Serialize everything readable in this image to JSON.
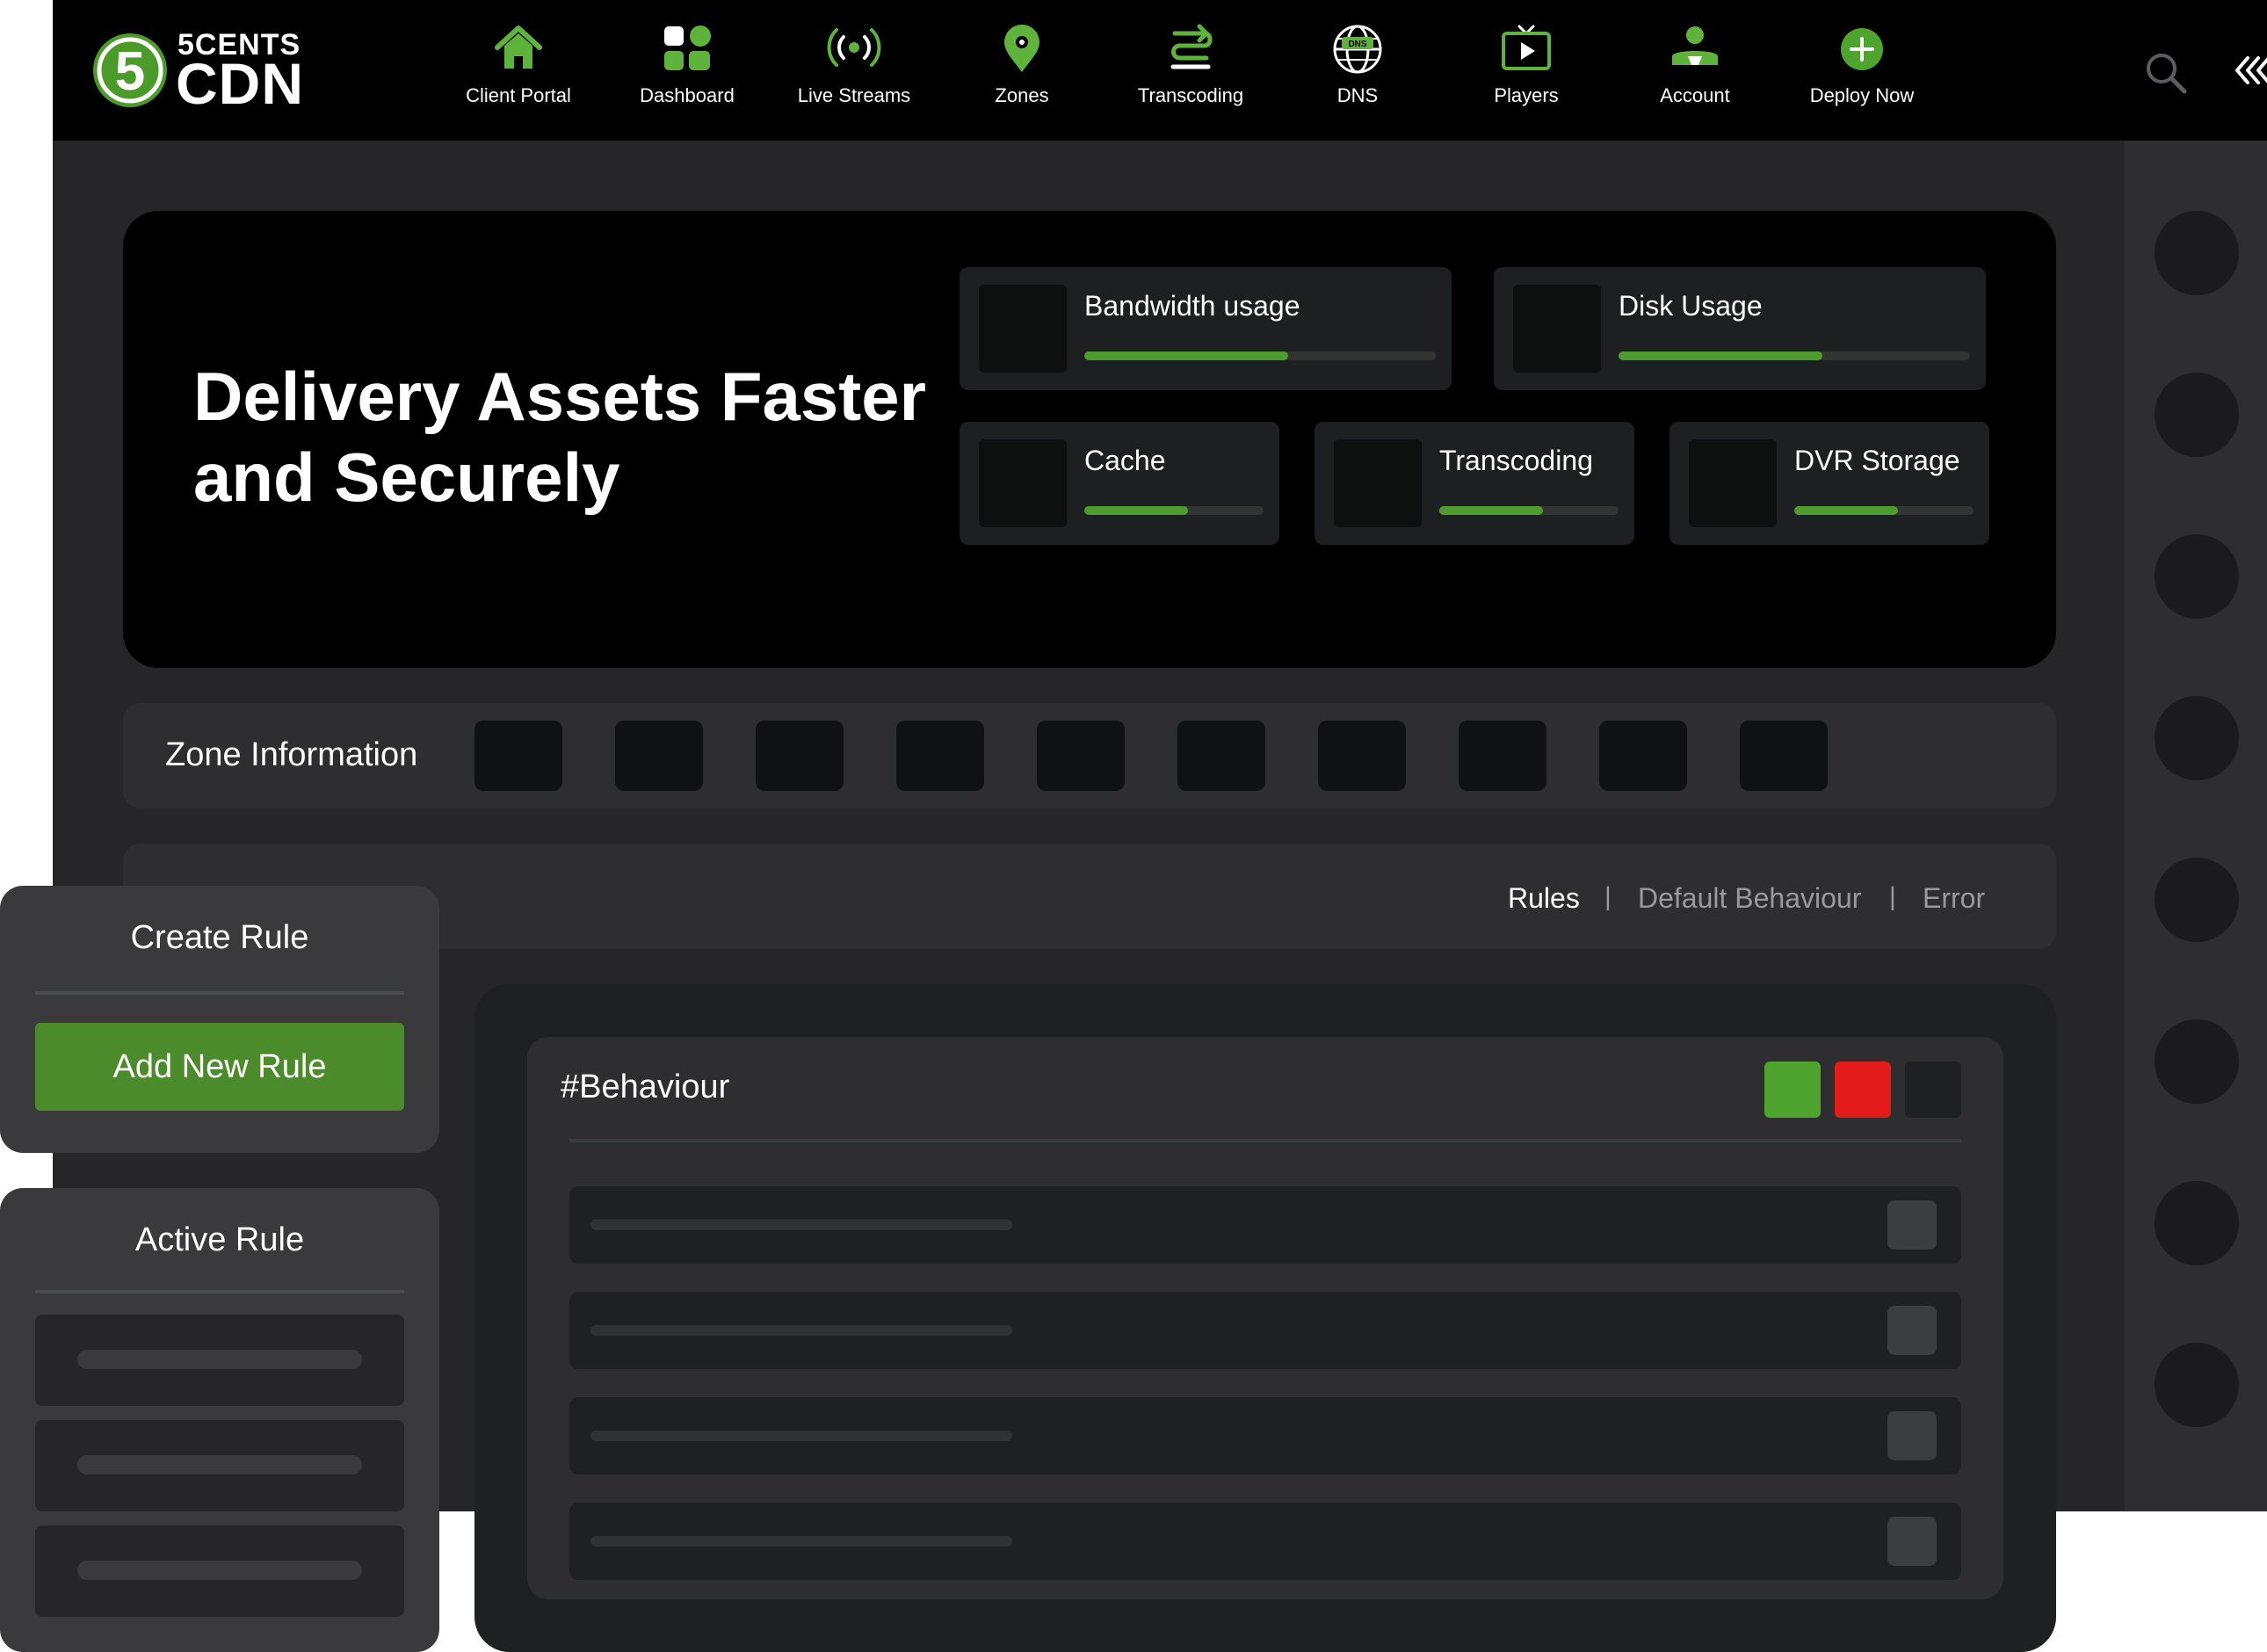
{
  "brand": {
    "logo_numeral": "5",
    "line1": "5CENTS",
    "line2": "CDN",
    "accent_color": "#4c9a2a"
  },
  "nav": {
    "items": [
      {
        "label": "Client Portal",
        "icon": "home-icon"
      },
      {
        "label": "Dashboard",
        "icon": "dashboard-grid-icon"
      },
      {
        "label": "Live Streams",
        "icon": "broadcast-icon"
      },
      {
        "label": "Zones",
        "icon": "location-pin-icon"
      },
      {
        "label": "Transcoding",
        "icon": "transcoding-arrows-icon"
      },
      {
        "label": "DNS",
        "icon": "dns-globe-icon"
      },
      {
        "label": "Players",
        "icon": "tv-play-icon"
      },
      {
        "label": "Account",
        "icon": "user-icon"
      },
      {
        "label": "Deploy Now",
        "icon": "plus-circle-icon"
      }
    ],
    "dns_badge": "DNS",
    "search_icon": "search-icon",
    "collapse_icon": "double-chevron-left-icon"
  },
  "hero": {
    "title_line1": "Delivery Assets Faster",
    "title_line2": "and Securely",
    "stats": [
      {
        "label": "Bandwidth usage",
        "progress": 0.58
      },
      {
        "label": "Disk Usage",
        "progress": 0.58
      },
      {
        "label": "Cache",
        "progress": 0.58
      },
      {
        "label": "Transcoding",
        "progress": 0.58
      },
      {
        "label": "DVR Storage",
        "progress": 0.58
      }
    ]
  },
  "zone": {
    "title": "Zone Information",
    "slots": 10
  },
  "tabs": {
    "items": [
      "Rules",
      "Default Behaviour",
      "Error"
    ],
    "separator": "|",
    "active_index": 0
  },
  "behaviour": {
    "title": "#Behaviour",
    "action_colors": [
      "#4fa32f",
      "#e31b1b",
      "#1f2021"
    ],
    "rows": 4
  },
  "create_rule": {
    "title": "Create Rule",
    "button_label": "Add New Rule"
  },
  "active_rule": {
    "title": "Active Rule",
    "items": 3
  },
  "colors": {
    "background": "#262628",
    "topbar": "#000000",
    "accent_green": "#4c8b2b",
    "progress_green": "#4e9c2e",
    "danger_red": "#e31b1b"
  }
}
